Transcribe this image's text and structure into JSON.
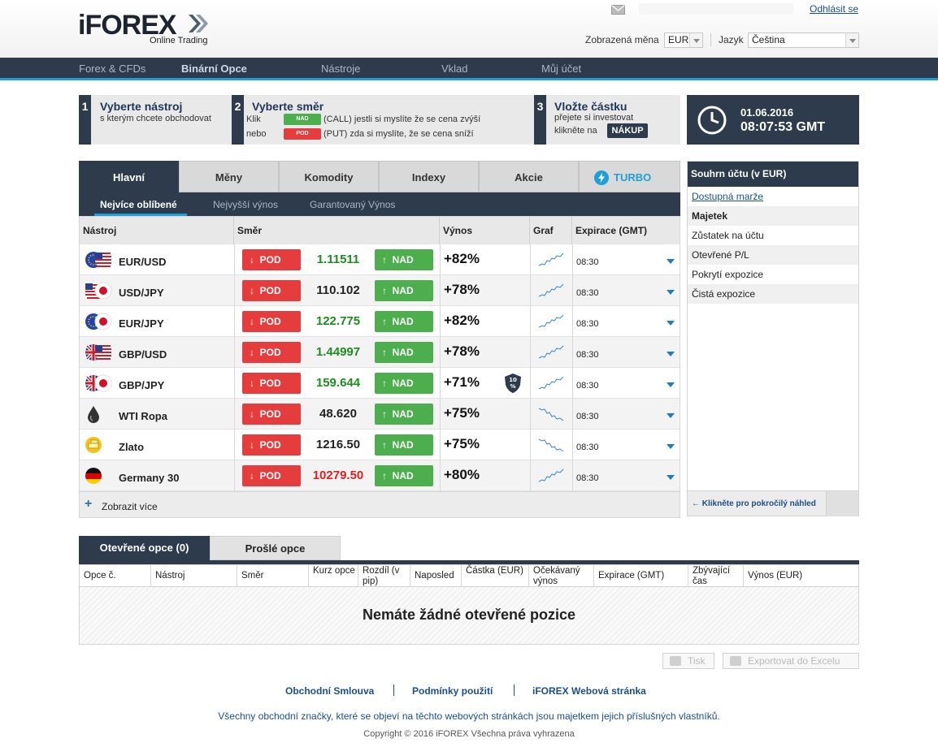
{
  "header": {
    "logo_name": "iFOREX",
    "logo_sub": "Online Trading",
    "logout": "Odhlásit se",
    "currency_label": "Zobrazená měna",
    "currency_value": "EUR",
    "language_label": "Jazyk",
    "language_value": "Čeština"
  },
  "nav": [
    "Forex & CFDs",
    "Binární Opce",
    "Nástroje",
    "Vklad",
    "Můj účet"
  ],
  "steps": {
    "s1": {
      "num": "1",
      "title": "Vyberte nástroj",
      "text": "s kterým chcete obchodovat"
    },
    "s2": {
      "num": "2",
      "title": "Vyberte směr",
      "klik": "Klik",
      "call": "(CALL) jestli si myslíte že se cena zvýší",
      "nebo": "nebo",
      "put": "(PUT) zda si myslíte, že se cena sníží",
      "nad": "NAD",
      "pod": "POD"
    },
    "s3": {
      "num": "3",
      "title": "Vložte částku",
      "text1": "přejete si investovat",
      "text2": "klikněte na",
      "buy": "NÁKUP"
    }
  },
  "clock": {
    "date": "01.06.2016",
    "time": "08:07:53 GMT"
  },
  "tabs": [
    "Hlavní",
    "Měny",
    "Komodity",
    "Indexy",
    "Akcie",
    "TURBO"
  ],
  "subtabs": [
    "Nejvíce oblíbené",
    "Nejvyšší výnos",
    "Garantovaný Výnos"
  ],
  "table": {
    "headers": [
      "Nástroj",
      "Směr",
      "Výnos",
      "Graf",
      "Expirace (GMT)"
    ],
    "pod_label": "POD",
    "nad_label": "NAD",
    "rows": [
      {
        "name": "EUR/USD",
        "price": "1.11511",
        "price_color": "#1e8c1e",
        "yield": "+82%",
        "expiry": "08:30",
        "flag": "eu-us",
        "trend": "up"
      },
      {
        "name": "USD/JPY",
        "price": "110.102",
        "price_color": "#222222",
        "yield": "+78%",
        "expiry": "08:30",
        "flag": "us-jp",
        "trend": "up"
      },
      {
        "name": "EUR/JPY",
        "price": "122.775",
        "price_color": "#1e8c1e",
        "yield": "+82%",
        "expiry": "08:30",
        "flag": "eu-jp",
        "trend": "up"
      },
      {
        "name": "GBP/USD",
        "price": "1.44997",
        "price_color": "#1e8c1e",
        "yield": "+78%",
        "expiry": "08:30",
        "flag": "gb-us",
        "trend": "up"
      },
      {
        "name": "GBP/JPY",
        "price": "159.644",
        "price_color": "#1e8c1e",
        "yield": "+71%",
        "expiry": "08:30",
        "flag": "gb-jp",
        "trend": "up",
        "badge": "10 %"
      },
      {
        "name": "WTI Ropa",
        "price": "48.620",
        "price_color": "#222222",
        "yield": "+75%",
        "expiry": "08:30",
        "flag": "oil",
        "trend": "down"
      },
      {
        "name": "Zlato",
        "price": "1216.50",
        "price_color": "#222222",
        "yield": "+75%",
        "expiry": "08:30",
        "flag": "gold",
        "trend": "down"
      },
      {
        "name": "Germany 30",
        "price": "10279.50",
        "price_color": "#e02020",
        "yield": "+80%",
        "expiry": "08:30",
        "flag": "de",
        "trend": "up"
      }
    ],
    "show_more": "Zobrazit více"
  },
  "account": {
    "title": "Souhrn účtu (v EUR)",
    "items": [
      "Dostupná marže",
      "Majetek",
      "Zůstatek na účtu",
      "Otevřené P/L",
      "Pokrytí expozice",
      "Čistá expozice"
    ],
    "advanced": "Klikněte pro pokročilý náhled"
  },
  "options": {
    "tab_open": "Otevřené opce (0)",
    "tab_expired": "Prošlé opce",
    "headers": [
      "Opce č.",
      "Nástroj",
      "Směr",
      "Kurz opce",
      "Rozdíl (v pip)",
      "Naposled",
      "Částka (EUR)",
      "Očekávaný výnos",
      "Expirace (GMT)",
      "Zbývající čas",
      "Výnos (EUR)"
    ],
    "empty": "Nemáte žádné otevřené pozice",
    "print": "Tisk",
    "export": "Exportovat do Excelu"
  },
  "footer": {
    "links": [
      "Obchodní Smlouva",
      "Podmínky použití",
      "iFOREX Webová stránka"
    ],
    "text": "Všechny obchodní značky, které se objeví na těchto webových stránkách jsou majetkem jejich příslušných vlastníků.",
    "copyright": "Copyright © 2016 iFOREX Všechna práva vyhrazena"
  },
  "colors": {
    "navy": "#2d3b4d",
    "accent": "#1f9fd7",
    "red": "#e53d3d",
    "green": "#4cae4c"
  }
}
